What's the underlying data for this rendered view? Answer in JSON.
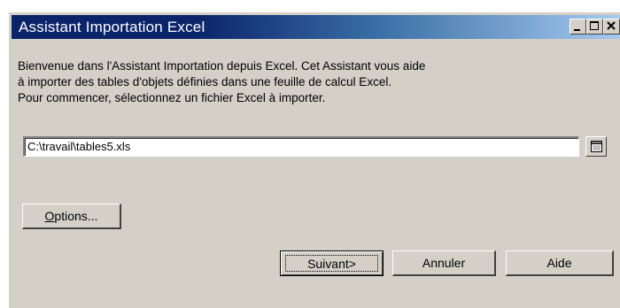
{
  "window": {
    "title": "Assistant Importation Excel",
    "controls": [
      "minimize-icon",
      "maximize-icon",
      "close-icon"
    ]
  },
  "intro": {
    "line1": "Bienvenue dans l'Assistant Importation depuis Excel. Cet Assistant vous aide",
    "line2": "à importer des tables d'objets définies dans une feuille de calcul Excel.",
    "line3": "Pour commencer, sélectionnez un fichier Excel à importer."
  },
  "file": {
    "value": "C:\\travail\\tables5.xls",
    "browse_icon": "browse-file-icon"
  },
  "buttons": {
    "options_mnemonic": "O",
    "options_rest": "ptions...",
    "next": "Suivant>",
    "cancel": "Annuler",
    "help": "Aide"
  },
  "colors": {
    "title_bar_start": "#0a246a",
    "title_bar_end": "#a6caf0",
    "dialog_face": "#d4d0c8"
  }
}
